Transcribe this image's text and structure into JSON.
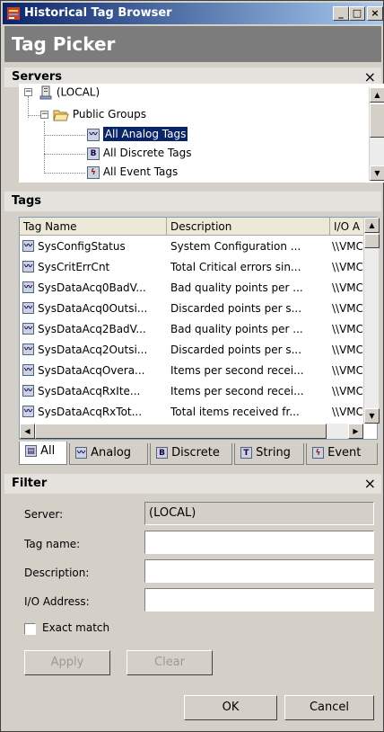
{
  "window": {
    "title": "Historical Tag Browser",
    "minimize": "_",
    "maximize": "□",
    "close": "×"
  },
  "header": {
    "title": "Tag Picker"
  },
  "servers": {
    "title": "Servers",
    "close": "×",
    "tree": [
      {
        "label": "(LOCAL)",
        "expander": "−"
      },
      {
        "label": "Public Groups",
        "expander": "−"
      },
      {
        "label": "All Analog Tags",
        "selected": true
      },
      {
        "label": "All Discrete Tags"
      },
      {
        "label": "All Event Tags"
      }
    ]
  },
  "tags": {
    "title": "Tags",
    "columns": [
      "Tag Name",
      "Description",
      "I/O A"
    ],
    "rows": [
      {
        "name": "SysConfigStatus",
        "desc": "System Configuration ...",
        "io": "\\\\VMC"
      },
      {
        "name": "SysCritErrCnt",
        "desc": "Total Critical errors sin...",
        "io": "\\\\VMC"
      },
      {
        "name": "SysDataAcq0BadV...",
        "desc": "Bad quality points per ...",
        "io": "\\\\VMC"
      },
      {
        "name": "SysDataAcq0Outsi...",
        "desc": "Discarded points per s...",
        "io": "\\\\VMC"
      },
      {
        "name": "SysDataAcq2BadV...",
        "desc": "Bad quality points per ...",
        "io": "\\\\VMC"
      },
      {
        "name": "SysDataAcq2Outsi...",
        "desc": "Discarded points per s...",
        "io": "\\\\VMC"
      },
      {
        "name": "SysDataAcqOvera...",
        "desc": "Items per second recei...",
        "io": "\\\\VMC"
      },
      {
        "name": "SysDataAcqRxIte...",
        "desc": "Items per second recei...",
        "io": "\\\\VMC"
      },
      {
        "name": "SysDataAcqRxTot...",
        "desc": "Total items received fr...",
        "io": "\\\\VMC"
      }
    ],
    "tabs": [
      "All",
      "Analog",
      "Discrete",
      "String",
      "Event"
    ]
  },
  "filter": {
    "title": "Filter",
    "close": "×",
    "server_label": "Server:",
    "server_value": "(LOCAL)",
    "tagname_label": "Tag name:",
    "tagname_value": "",
    "description_label": "Description:",
    "description_value": "",
    "io_label": "I/O Address:",
    "io_value": "",
    "exact_match": "Exact match",
    "apply": "Apply",
    "clear": "Clear"
  },
  "buttons": {
    "ok": "OK",
    "cancel": "Cancel"
  }
}
